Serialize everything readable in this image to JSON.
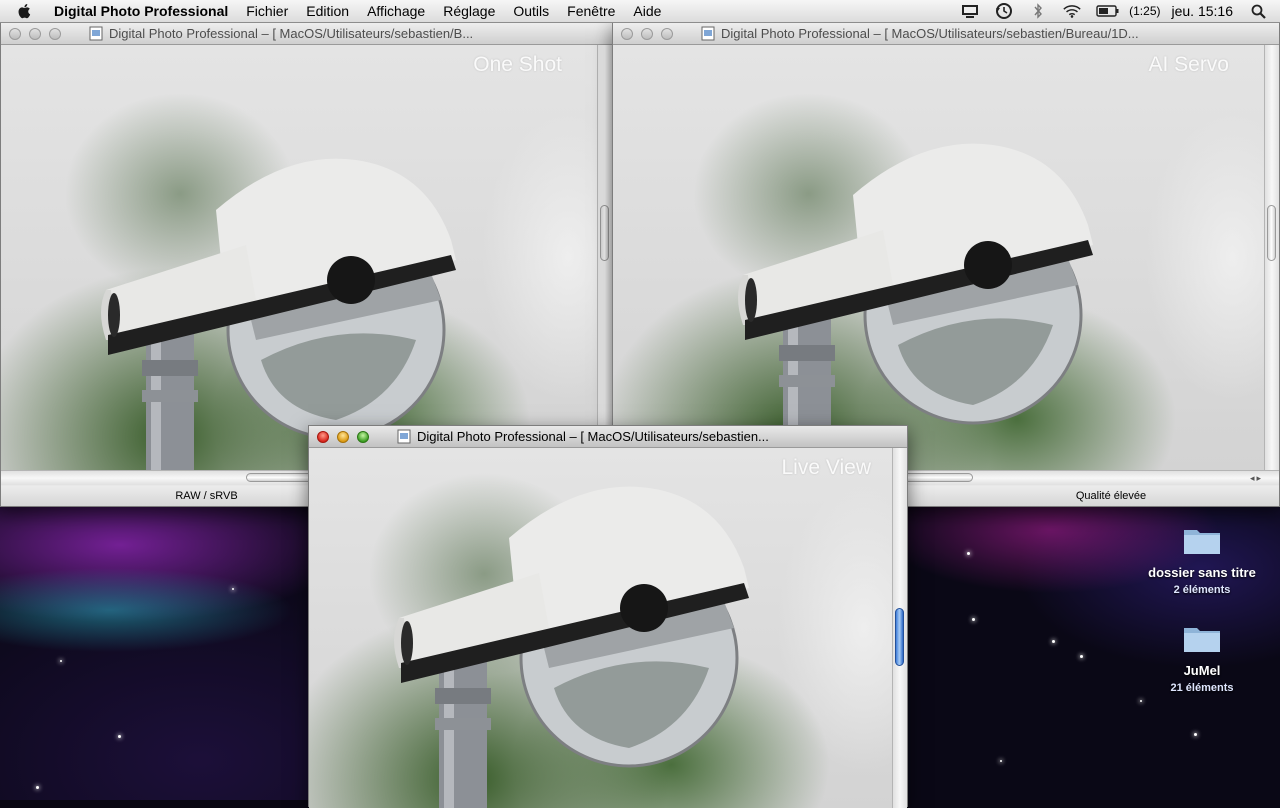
{
  "menubar": {
    "app_name": "Digital Photo Professional",
    "items": [
      "Fichier",
      "Edition",
      "Affichage",
      "Réglage",
      "Outils",
      "Fenêtre",
      "Aide"
    ],
    "battery_time": "(1:25)",
    "clock": "jeu. 15:16"
  },
  "windows": {
    "left": {
      "title": "Digital Photo Professional – [ MacOS/Utilisateurs/sebastien/B...",
      "mode_label": "One Shot",
      "status": "RAW / sRVB"
    },
    "right": {
      "title": "Digital Photo Professional – [ MacOS/Utilisateurs/sebastien/Bureau/1D...",
      "mode_label": "AI Servo",
      "status": "Qualité élevée"
    },
    "front": {
      "title": "Digital Photo Professional – [ MacOS/Utilisateurs/sebastien...",
      "mode_label": "Live View"
    }
  },
  "desktop_icons": [
    {
      "name": "dossier sans titre",
      "count": "2 éléments"
    },
    {
      "name": "JuMel",
      "count": "21 éléments"
    }
  ],
  "icons": [
    "apple-icon",
    "display-icon",
    "time-machine-icon",
    "bluetooth-icon",
    "wifi-icon",
    "battery-icon",
    "spotlight-icon",
    "document-icon",
    "folder-icon"
  ]
}
